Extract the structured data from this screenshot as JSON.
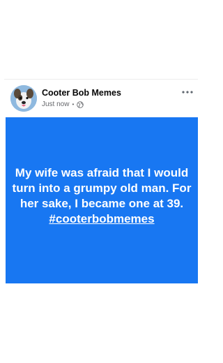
{
  "post": {
    "page_name": "Cooter Bob Memes",
    "timestamp": "Just now",
    "separator": "•",
    "privacy_icon": "globe-icon",
    "more_icon": "more-options-icon",
    "avatar_icon": "dog-avatar-icon",
    "body_text": "My wife was afraid that I would turn into a grumpy old man. For her sake, I became one at 39.",
    "hashtag": "#cooterbobmemes",
    "background_color": "#1877f2",
    "text_color": "#ffffff"
  }
}
